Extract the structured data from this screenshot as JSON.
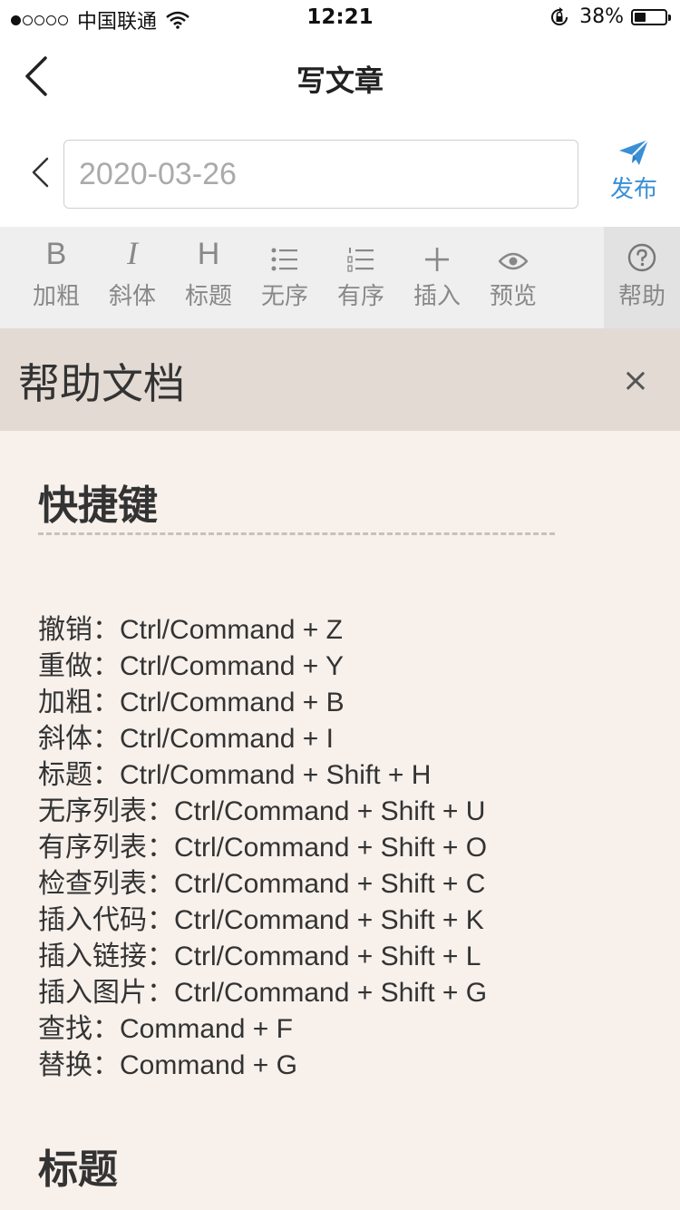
{
  "status_bar": {
    "carrier": "中国联通",
    "time": "12:21",
    "battery_percent": "38%",
    "battery_level": 0.38,
    "signal_bars_filled": 1,
    "signal_bars_total": 5
  },
  "nav": {
    "title": "写文章"
  },
  "editor": {
    "title_value": "",
    "title_placeholder": "2020-03-26",
    "publish_label": "发布",
    "accent_color": "#3a8fd6"
  },
  "toolbar": {
    "items": [
      {
        "label": "加粗"
      },
      {
        "label": "斜体"
      },
      {
        "label": "标题"
      },
      {
        "label": "无序"
      },
      {
        "label": "有序"
      },
      {
        "label": "插入"
      },
      {
        "label": "预览"
      }
    ],
    "bold_glyph": "B",
    "italic_glyph": "I",
    "heading_glyph": "H",
    "help_label": "帮助"
  },
  "help": {
    "title": "帮助文档",
    "close_label": "×",
    "sections": [
      {
        "heading": "快捷键",
        "divider": "------------------------------",
        "shortcuts": [
          "撤销：Ctrl/Command + Z",
          "重做：Ctrl/Command + Y",
          "加粗：Ctrl/Command + B",
          "斜体：Ctrl/Command + I",
          "标题：Ctrl/Command + Shift + H",
          "无序列表：Ctrl/Command + Shift + U",
          "有序列表：Ctrl/Command + Shift + O",
          "检查列表：Ctrl/Command + Shift + C",
          "插入代码：Ctrl/Command + Shift + K",
          "插入链接：Ctrl/Command + Shift + L",
          "插入图片：Ctrl/Command + Shift + G",
          "查找：Command + F",
          "替换：Command + G"
        ]
      },
      {
        "heading": "标题"
      }
    ]
  }
}
